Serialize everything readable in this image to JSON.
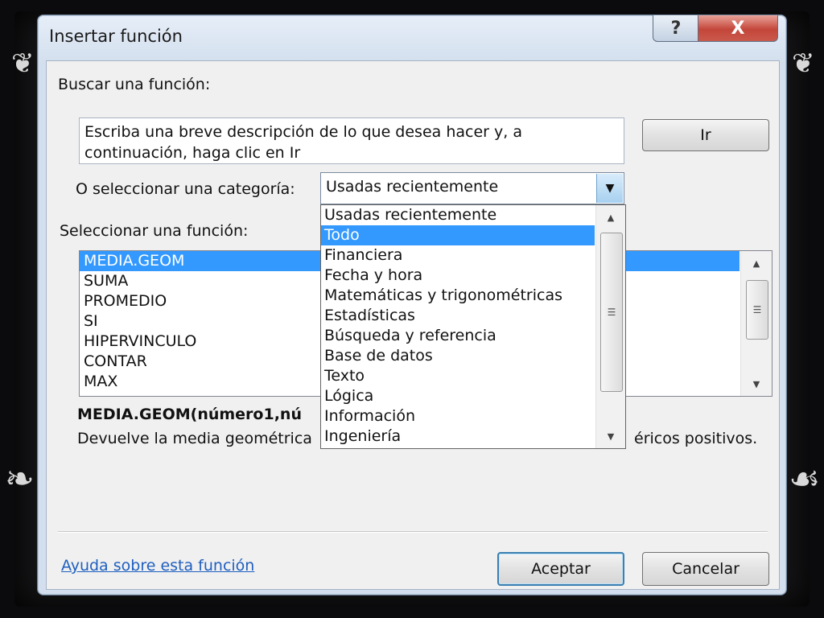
{
  "dialog": {
    "title": "Insertar función",
    "help_glyph": "?",
    "close_glyph": "X"
  },
  "search": {
    "label": "Buscar una función:",
    "description": "Escriba una breve descripción de lo que desea hacer y, a continuación, haga clic en Ir",
    "go_button": "Ir"
  },
  "category": {
    "label": "O seleccionar una categoría:",
    "selected": "Usadas recientemente",
    "options": [
      "Usadas recientemente",
      "Todo",
      "Financiera",
      "Fecha y hora",
      "Matemáticas y trigonométricas",
      "Estadísticas",
      "Búsqueda y referencia",
      "Base de datos",
      "Texto",
      "Lógica",
      "Información",
      "Ingeniería"
    ],
    "highlighted_index": 1
  },
  "functions": {
    "label": "Seleccionar una función:",
    "items": [
      "MEDIA.GEOM",
      "SUMA",
      "PROMEDIO",
      "SI",
      "HIPERVINCULO",
      "CONTAR",
      "MAX"
    ],
    "selected_index": 0,
    "signature_visible": "MEDIA.GEOM(número1,nú",
    "description_left": "Devuelve la media geométrica",
    "description_right": "éricos positivos."
  },
  "footer": {
    "help_link": "Ayuda sobre esta función",
    "ok_button": "Aceptar",
    "cancel_button": "Cancelar"
  },
  "colors": {
    "selection": "#3399ff",
    "link": "#1f5fbf",
    "close_red": "#c4463a"
  },
  "icons": {
    "dropdown_arrow": "triangle-down",
    "scroll_up": "triangle-up",
    "scroll_down": "triangle-down",
    "scroll_grip": "grip-lines"
  }
}
